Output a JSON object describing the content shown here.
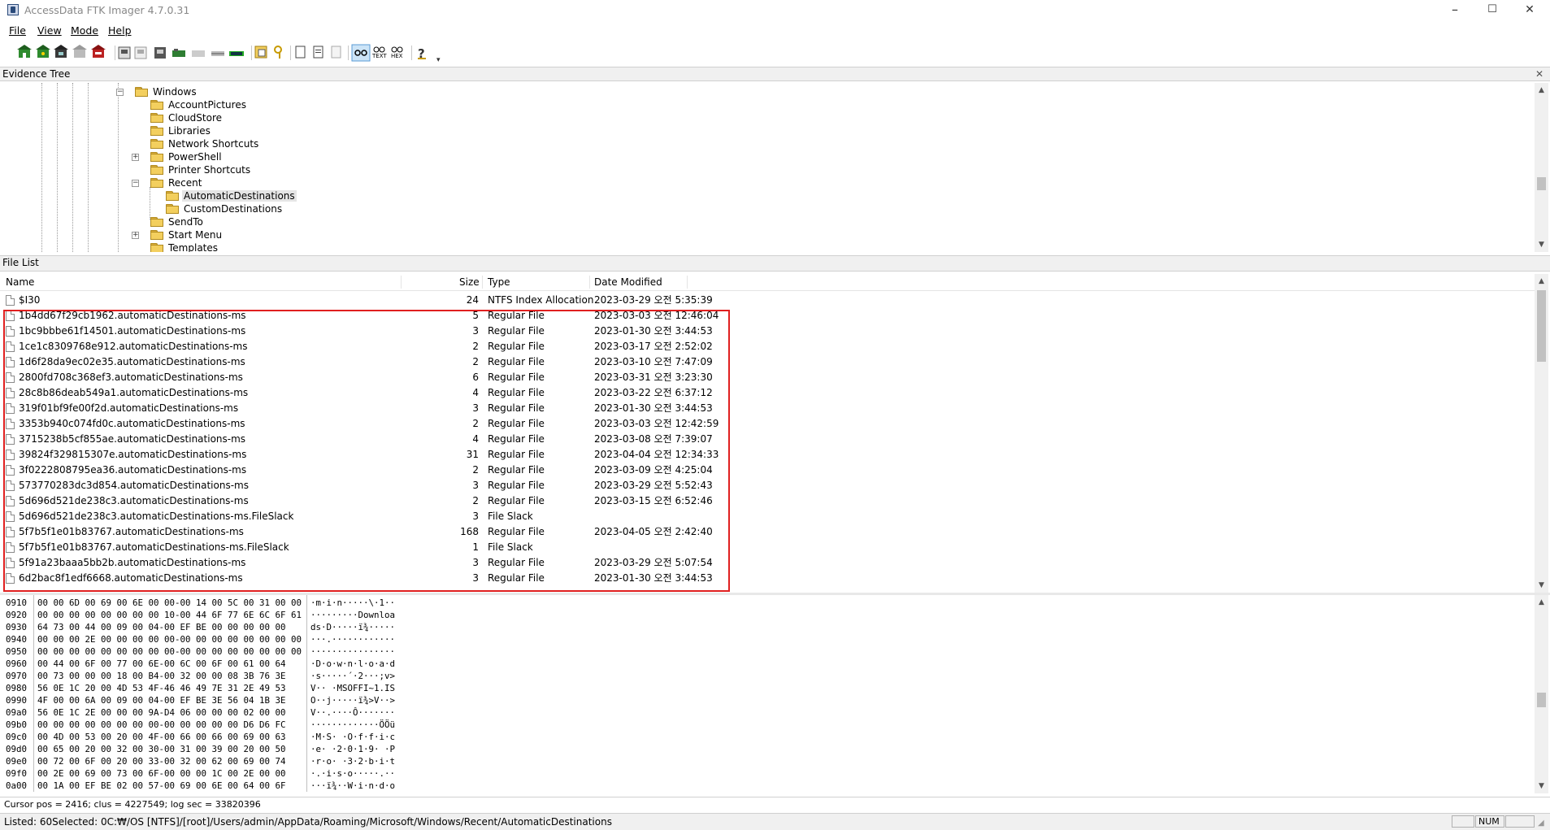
{
  "window": {
    "title": "AccessData FTK Imager 4.7.0.31",
    "minimize": "–",
    "maximize": "☐",
    "close": "✕"
  },
  "menu": {
    "file": "File",
    "view": "View",
    "mode": "Mode",
    "help": "Help"
  },
  "evidence_tree": {
    "header": "Evidence Tree",
    "close": "✕",
    "items": [
      {
        "label": "Windows",
        "level": 0,
        "expander": "−"
      },
      {
        "label": "AccountPictures",
        "level": 1,
        "expander": ""
      },
      {
        "label": "CloudStore",
        "level": 1,
        "expander": ""
      },
      {
        "label": "Libraries",
        "level": 1,
        "expander": ""
      },
      {
        "label": "Network Shortcuts",
        "level": 1,
        "expander": ""
      },
      {
        "label": "PowerShell",
        "level": 1,
        "expander": "+"
      },
      {
        "label": "Printer Shortcuts",
        "level": 1,
        "expander": ""
      },
      {
        "label": "Recent",
        "level": 1,
        "expander": "−"
      },
      {
        "label": "AutomaticDestinations",
        "level": 2,
        "expander": "",
        "selected": true
      },
      {
        "label": "CustomDestinations",
        "level": 2,
        "expander": ""
      },
      {
        "label": "SendTo",
        "level": 1,
        "expander": ""
      },
      {
        "label": "Start Menu",
        "level": 1,
        "expander": "+"
      },
      {
        "label": "Templates",
        "level": 1,
        "expander": ""
      }
    ]
  },
  "file_list": {
    "header": "File List",
    "columns": {
      "name": "Name",
      "size": "Size",
      "type": "Type",
      "date": "Date Modified"
    },
    "rows": [
      {
        "name": "$I30",
        "size": "24",
        "type": "NTFS Index Allocation",
        "date": "2023-03-29 오전 5:35:39"
      },
      {
        "name": "1b4dd67f29cb1962.automaticDestinations-ms",
        "size": "5",
        "type": "Regular File",
        "date": "2023-03-03 오전 12:46:04"
      },
      {
        "name": "1bc9bbbe61f14501.automaticDestinations-ms",
        "size": "3",
        "type": "Regular File",
        "date": "2023-01-30 오전 3:44:53"
      },
      {
        "name": "1ce1c8309768e912.automaticDestinations-ms",
        "size": "2",
        "type": "Regular File",
        "date": "2023-03-17 오전 2:52:02"
      },
      {
        "name": "1d6f28da9ec02e35.automaticDestinations-ms",
        "size": "2",
        "type": "Regular File",
        "date": "2023-03-10 오전 7:47:09"
      },
      {
        "name": "2800fd708c368ef3.automaticDestinations-ms",
        "size": "6",
        "type": "Regular File",
        "date": "2023-03-31 오전 3:23:30"
      },
      {
        "name": "28c8b86deab549a1.automaticDestinations-ms",
        "size": "4",
        "type": "Regular File",
        "date": "2023-03-22 오전 6:37:12"
      },
      {
        "name": "319f01bf9fe00f2d.automaticDestinations-ms",
        "size": "3",
        "type": "Regular File",
        "date": "2023-01-30 오전 3:44:53"
      },
      {
        "name": "3353b940c074fd0c.automaticDestinations-ms",
        "size": "2",
        "type": "Regular File",
        "date": "2023-03-03 오전 12:42:59"
      },
      {
        "name": "3715238b5cf855ae.automaticDestinations-ms",
        "size": "4",
        "type": "Regular File",
        "date": "2023-03-08 오전 7:39:07"
      },
      {
        "name": "39824f329815307e.automaticDestinations-ms",
        "size": "31",
        "type": "Regular File",
        "date": "2023-04-04 오전 12:34:33"
      },
      {
        "name": "3f0222808795ea36.automaticDestinations-ms",
        "size": "2",
        "type": "Regular File",
        "date": "2023-03-09 오전 4:25:04"
      },
      {
        "name": "573770283dc3d854.automaticDestinations-ms",
        "size": "3",
        "type": "Regular File",
        "date": "2023-03-29 오전 5:52:43"
      },
      {
        "name": "5d696d521de238c3.automaticDestinations-ms",
        "size": "2",
        "type": "Regular File",
        "date": "2023-03-15 오전 6:52:46"
      },
      {
        "name": "5d696d521de238c3.automaticDestinations-ms.FileSlack",
        "size": "3",
        "type": "File Slack",
        "date": ""
      },
      {
        "name": "5f7b5f1e01b83767.automaticDestinations-ms",
        "size": "168",
        "type": "Regular File",
        "date": "2023-04-05 오전 2:42:40"
      },
      {
        "name": "5f7b5f1e01b83767.automaticDestinations-ms.FileSlack",
        "size": "1",
        "type": "File Slack",
        "date": ""
      },
      {
        "name": "5f91a23baaa5bb2b.automaticDestinations-ms",
        "size": "3",
        "type": "Regular File",
        "date": "2023-03-29 오전 5:07:54"
      },
      {
        "name": "6d2bac8f1edf6668.automaticDestinations-ms",
        "size": "3",
        "type": "Regular File",
        "date": "2023-01-30 오전 3:44:53"
      }
    ]
  },
  "hex_view": {
    "rows": [
      {
        "offset": "0910",
        "bytes": "00 00 6D 00 69 00 6E 00 00-00 14 00 5C 00 31 00 00",
        "ascii": "·m·i·n·····\\·1··"
      },
      {
        "offset": "0920",
        "bytes": "00 00 00 00 00 00 00 00 10-00 44 6F 77 6E 6C 6F 61",
        "ascii": "·········Downloa"
      },
      {
        "offset": "0930",
        "bytes": "64 73 00 44 00 09 00 04-00 EF BE 00 00 00 00 00",
        "ascii": "ds·D·····ï¾·····"
      },
      {
        "offset": "0940",
        "bytes": "00 00 00 2E 00 00 00 00 00-00 00 00 00 00 00 00 00",
        "ascii": "···.············"
      },
      {
        "offset": "0950",
        "bytes": "00 00 00 00 00 00 00 00 00-00 00 00 00 00 00 00 00",
        "ascii": "················"
      },
      {
        "offset": "0960",
        "bytes": "00 44 00 6F 00 77 00 6E-00 6C 00 6F 00 61 00 64",
        "ascii": "·D·o·w·n·l·o·a·d"
      },
      {
        "offset": "0970",
        "bytes": "00 73 00 00 00 18 00 B4-00 32 00 00 08 3B 76 3E",
        "ascii": "·s·····´·2···;v>"
      },
      {
        "offset": "0980",
        "bytes": "56 0E 1C 20 00 4D 53 4F-46 46 49 7E 31 2E 49 53",
        "ascii": "V·· ·MSOFFI~1.IS"
      },
      {
        "offset": "0990",
        "bytes": "4F 00 00 6A 00 09 00 04-00 EF BE 3E 56 04 1B 3E",
        "ascii": "O··j·····ï¾>V··>"
      },
      {
        "offset": "09a0",
        "bytes": "56 0E 1C 2E 00 00 00 9A-D4 06 00 00 00 02 00 00",
        "ascii": "V··.····Ô·······"
      },
      {
        "offset": "09b0",
        "bytes": "00 00 00 00 00 00 00 00-00 00 00 00 00 D6 D6 FC",
        "ascii": "·············ÖÖü"
      },
      {
        "offset": "09c0",
        "bytes": "00 4D 00 53 00 20 00 4F-00 66 00 66 00 69 00 63",
        "ascii": "·M·S· ·O·f·f·i·c"
      },
      {
        "offset": "09d0",
        "bytes": "00 65 00 20 00 32 00 30-00 31 00 39 00 20 00 50",
        "ascii": "·e· ·2·0·1·9· ·P"
      },
      {
        "offset": "09e0",
        "bytes": "00 72 00 6F 00 20 00 33-00 32 00 62 00 69 00 74",
        "ascii": "·r·o· ·3·2·b·i·t"
      },
      {
        "offset": "09f0",
        "bytes": "00 2E 00 69 00 73 00 6F-00 00 00 1C 00 2E 00 00",
        "ascii": "·.·i·s·o·····.··"
      },
      {
        "offset": "0a00",
        "bytes": "00 1A 00 EF BE 02 00 57-00 69 00 6E 00 64 00 6F",
        "ascii": "···ï¾··W·i·n·d·o"
      }
    ]
  },
  "cursor_info": "Cursor pos = 2416; clus = 4227549; log sec = 33820396",
  "status": {
    "text": "Listed: 60Selected: 0C:₩/OS [NTFS]/[root]/Users/admin/AppData/Roaming/Microsoft/Windows/Recent/AutomaticDestinations",
    "num": "NUM"
  },
  "colors": {
    "highlight_border": "#e02020",
    "folder": "#f3cf5e",
    "selection": "#e5e5e5"
  }
}
